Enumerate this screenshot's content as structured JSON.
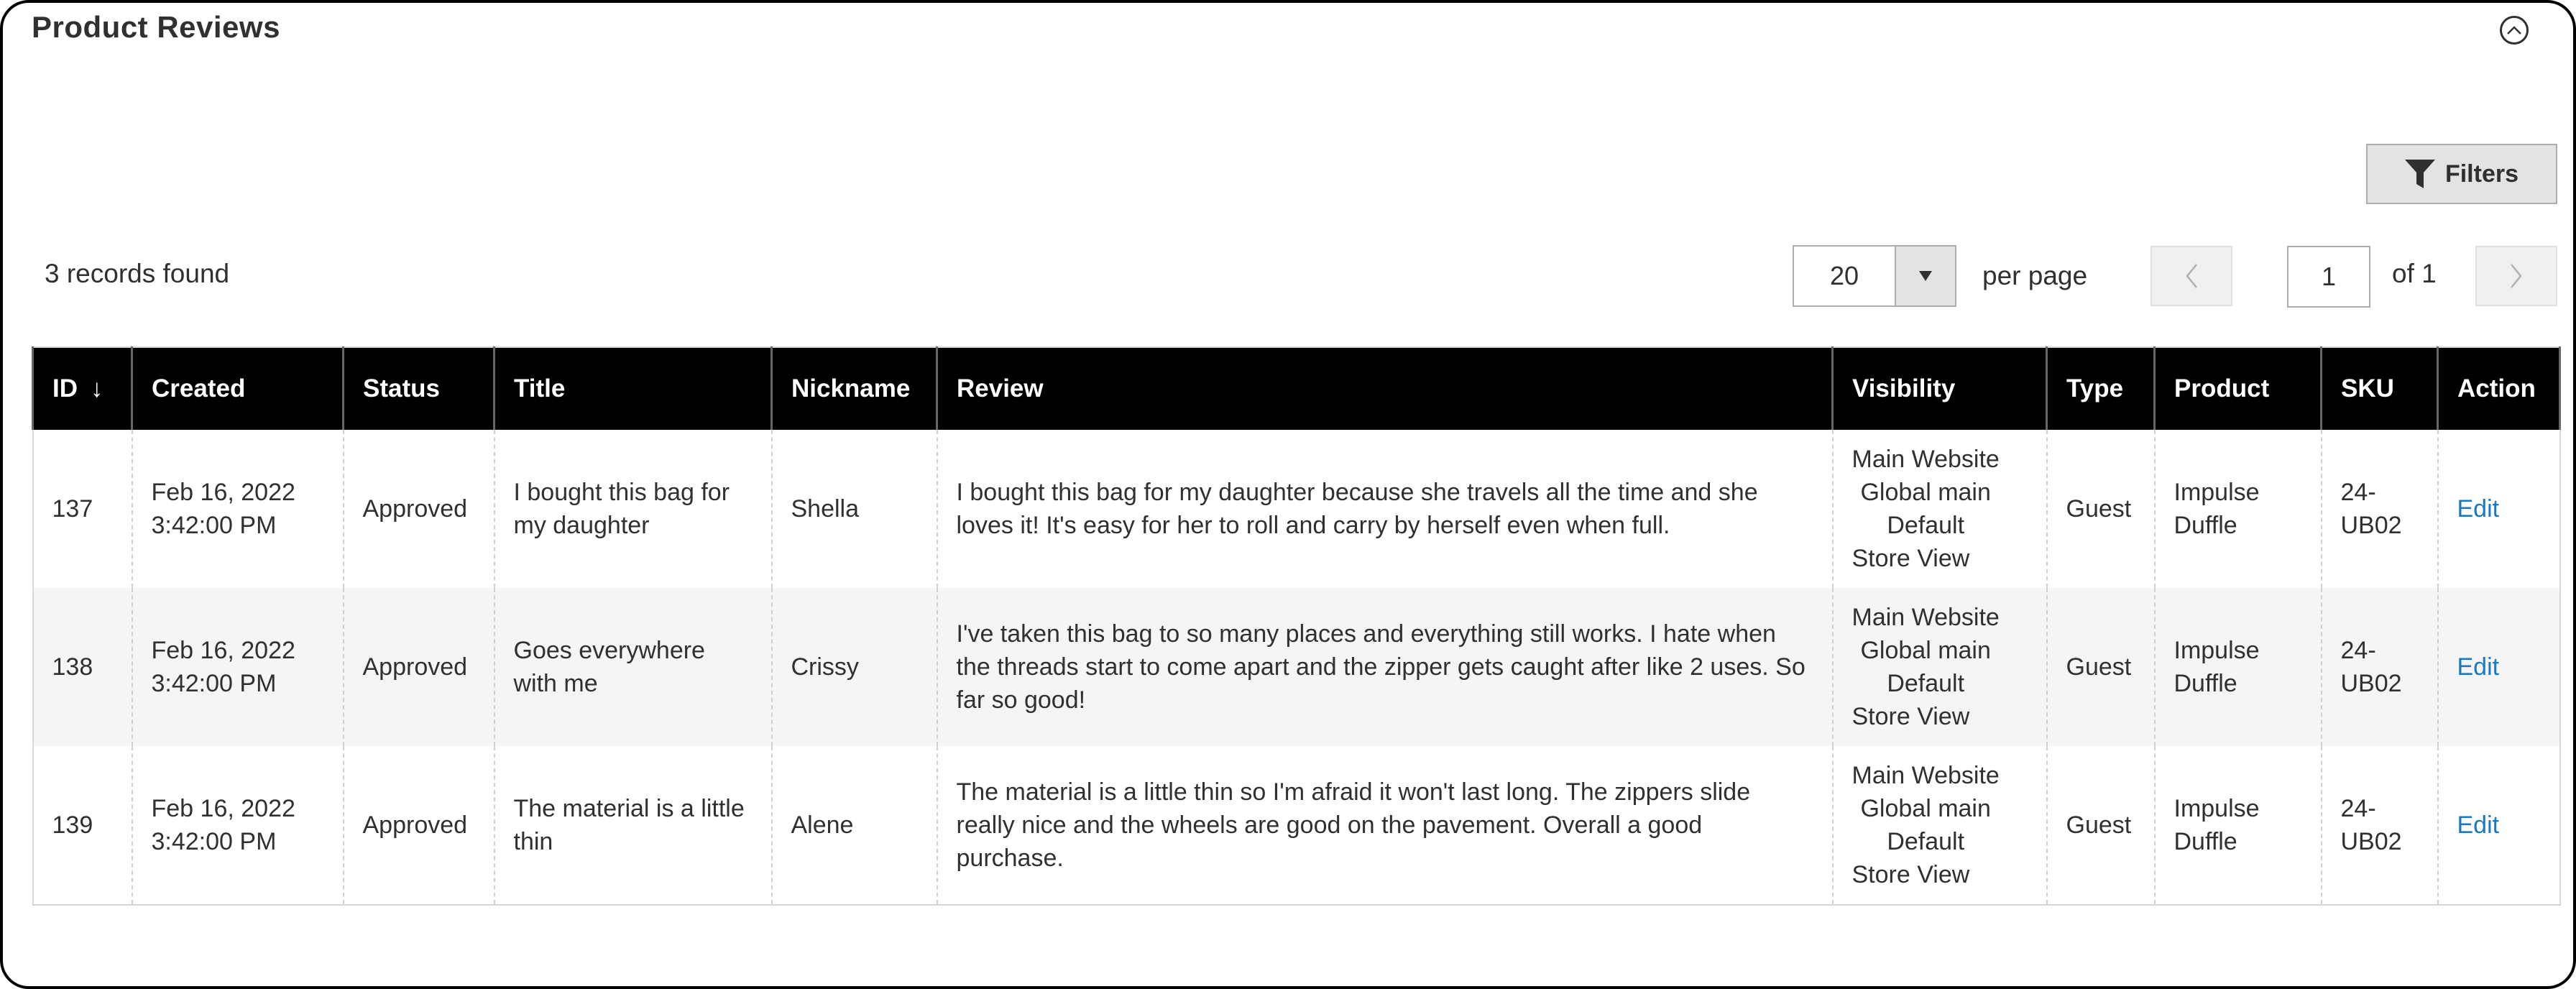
{
  "panel": {
    "title": "Product Reviews",
    "collapse_icon": "chevron-up-circle-icon"
  },
  "toolbar": {
    "filters_label": "Filters",
    "filters_icon": "funnel-icon",
    "records_found": "3 records found",
    "per_page_value": "20",
    "per_page_label": "per page",
    "current_page": "1",
    "page_total_label": "of 1"
  },
  "table": {
    "columns": [
      "ID",
      "Created",
      "Status",
      "Title",
      "Nickname",
      "Review",
      "Visibility",
      "Type",
      "Product",
      "SKU",
      "Action"
    ],
    "sort_indicator": "↓",
    "rows": [
      {
        "id": "137",
        "created_date": "Feb 16, 2022",
        "created_time": "3:42:00 PM",
        "status": "Approved",
        "title": "I bought this bag for my daughter",
        "nickname": "Shella",
        "review": "I bought this bag for my daughter because she travels all the time and she loves it! It's easy for her to roll and carry by herself even when full.",
        "visibility": [
          "Main Website",
          "Global main",
          "Default",
          "Store View"
        ],
        "type": "Guest",
        "product": "Impulse Duffle",
        "sku": "24-UB02",
        "action": "Edit"
      },
      {
        "id": "138",
        "created_date": "Feb 16, 2022",
        "created_time": "3:42:00 PM",
        "status": "Approved",
        "title": "Goes everywhere with me",
        "nickname": "Crissy",
        "review": "I've taken this bag to so many places and everything still works. I hate when the threads start to come apart and the zipper gets caught after like 2 uses. So far so good!",
        "visibility": [
          "Main Website",
          "Global main",
          "Default",
          "Store View"
        ],
        "type": "Guest",
        "product": "Impulse Duffle",
        "sku": "24-UB02",
        "action": "Edit"
      },
      {
        "id": "139",
        "created_date": "Feb 16, 2022",
        "created_time": "3:42:00 PM",
        "status": "Approved",
        "title": "The material is a little thin",
        "nickname": "Alene",
        "review": "The material is a little thin so I'm afraid it won't last long. The zippers slide really nice and the wheels are good on the pavement. Overall a good purchase.",
        "visibility": [
          "Main Website",
          "Global main",
          "Default",
          "Store View"
        ],
        "type": "Guest",
        "product": "Impulse Duffle",
        "sku": "24-UB02",
        "action": "Edit"
      }
    ]
  },
  "colors": {
    "header_bg": "#000000",
    "link": "#1979c3",
    "alt_row": "#f5f5f5",
    "button_bg": "#e3e3e3"
  }
}
